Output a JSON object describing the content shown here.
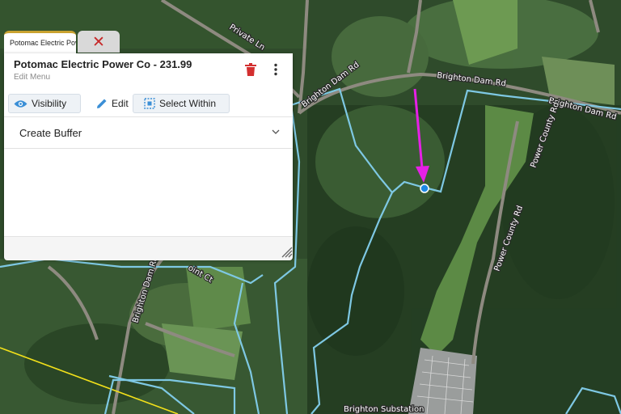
{
  "tabs": {
    "active_label": "Potomac Electric Pov",
    "close_symbol": "✕"
  },
  "panel": {
    "title": "Potomac Electric Power Co - 231.99",
    "subtitle": "Edit Menu",
    "icons": {
      "delete": "trash-icon",
      "more": "more-vert-icon"
    },
    "toolbar": {
      "visibility_label": "Visibility",
      "edit_label": "Edit",
      "select_within_label": "Select Within"
    },
    "accordion": {
      "label": "Create Buffer"
    }
  },
  "map": {
    "labels": {
      "brighton_dam_rd_1": "Brighton Dam Rd",
      "brighton_dam_rd_2": "Brighton Dam Rd",
      "brighton_dam_rd_3": "Brighton Dam Rd",
      "brighton_dam_rd_4": "Brighton Dam Rd",
      "power_county_rd_1": "Power County Rd",
      "power_county_rd_2": "Power County Rd",
      "private_ln": "Private Ln",
      "point_ct": "oint Ct",
      "substation": "Brighton Substation"
    },
    "colors": {
      "parcel_outline": "#7ec8e3",
      "arrow": "#e620e6",
      "power_line": "#f2e01a",
      "vertex": "#1e88e5"
    }
  }
}
